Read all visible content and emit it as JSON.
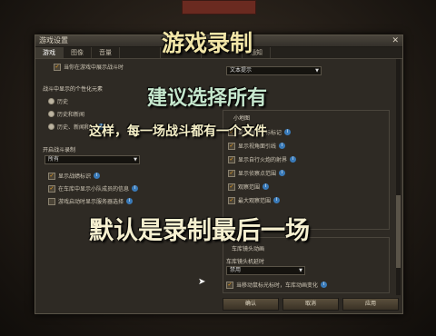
{
  "dialog": {
    "title": "游戏设置",
    "close": "✕",
    "tabs": [
      "游戏",
      "图像",
      "音量",
      "",
      "",
      "",
      "通知"
    ],
    "top_text": "当你在游戏中展示战斗时"
  },
  "left": {
    "section1": "战斗中显示的个性化元素",
    "radios": [
      "历史",
      "历史和新闻",
      "历史、新闻和..."
    ],
    "section2": "开启战斗录制",
    "record_select": "所有",
    "checks": [
      "显示战绩标识",
      "在车库中显示小队成员的信息",
      "游戏启动时显示服务器选择"
    ]
  },
  "right": {
    "select1": "文本提示",
    "map_header": "小地图",
    "checks": [
      "显示地图坐标标记",
      "显示视角面引线",
      "显示自行火炮的射界",
      "显示侦察点范围",
      "观察范围",
      "最大观察范围"
    ],
    "garage_header": "车库镜头动画",
    "garage_sub": "车库镜头机延时",
    "garage_select": "禁用",
    "garage_check": "当移动鼠标光标时，车库动画变化"
  },
  "buttons": {
    "ok": "确认",
    "cancel": "取消",
    "apply": "应用"
  },
  "overlay": {
    "title": "游戏录制",
    "suggest": "建议选择所有",
    "sub": "这样，每一场战斗都有一个文件",
    "default": "默认是录制最后一场"
  },
  "icons": {
    "info": "i",
    "check": "✓"
  },
  "colors": {
    "accent": "#f0a020",
    "info": "#3a7ab8"
  }
}
